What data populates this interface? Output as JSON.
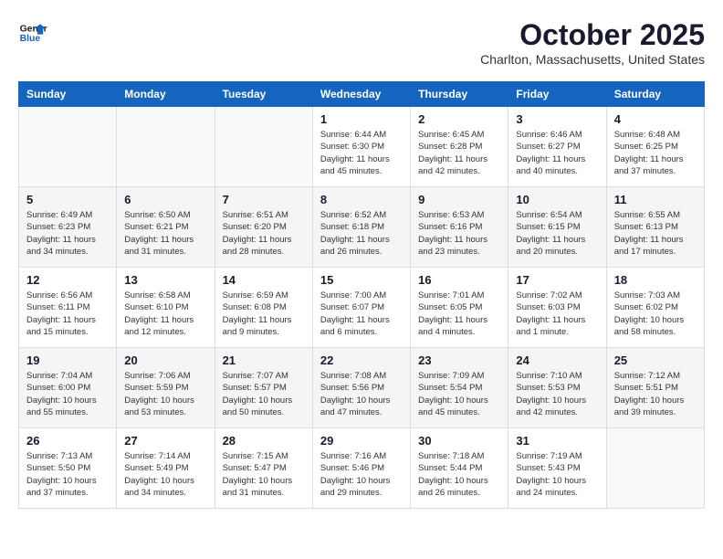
{
  "header": {
    "logo_line1": "General",
    "logo_line2": "Blue",
    "month": "October 2025",
    "location": "Charlton, Massachusetts, United States"
  },
  "days_of_week": [
    "Sunday",
    "Monday",
    "Tuesday",
    "Wednesday",
    "Thursday",
    "Friday",
    "Saturday"
  ],
  "weeks": [
    [
      {
        "day": "",
        "info": ""
      },
      {
        "day": "",
        "info": ""
      },
      {
        "day": "",
        "info": ""
      },
      {
        "day": "1",
        "info": "Sunrise: 6:44 AM\nSunset: 6:30 PM\nDaylight: 11 hours\nand 45 minutes."
      },
      {
        "day": "2",
        "info": "Sunrise: 6:45 AM\nSunset: 6:28 PM\nDaylight: 11 hours\nand 42 minutes."
      },
      {
        "day": "3",
        "info": "Sunrise: 6:46 AM\nSunset: 6:27 PM\nDaylight: 11 hours\nand 40 minutes."
      },
      {
        "day": "4",
        "info": "Sunrise: 6:48 AM\nSunset: 6:25 PM\nDaylight: 11 hours\nand 37 minutes."
      }
    ],
    [
      {
        "day": "5",
        "info": "Sunrise: 6:49 AM\nSunset: 6:23 PM\nDaylight: 11 hours\nand 34 minutes."
      },
      {
        "day": "6",
        "info": "Sunrise: 6:50 AM\nSunset: 6:21 PM\nDaylight: 11 hours\nand 31 minutes."
      },
      {
        "day": "7",
        "info": "Sunrise: 6:51 AM\nSunset: 6:20 PM\nDaylight: 11 hours\nand 28 minutes."
      },
      {
        "day": "8",
        "info": "Sunrise: 6:52 AM\nSunset: 6:18 PM\nDaylight: 11 hours\nand 26 minutes."
      },
      {
        "day": "9",
        "info": "Sunrise: 6:53 AM\nSunset: 6:16 PM\nDaylight: 11 hours\nand 23 minutes."
      },
      {
        "day": "10",
        "info": "Sunrise: 6:54 AM\nSunset: 6:15 PM\nDaylight: 11 hours\nand 20 minutes."
      },
      {
        "day": "11",
        "info": "Sunrise: 6:55 AM\nSunset: 6:13 PM\nDaylight: 11 hours\nand 17 minutes."
      }
    ],
    [
      {
        "day": "12",
        "info": "Sunrise: 6:56 AM\nSunset: 6:11 PM\nDaylight: 11 hours\nand 15 minutes."
      },
      {
        "day": "13",
        "info": "Sunrise: 6:58 AM\nSunset: 6:10 PM\nDaylight: 11 hours\nand 12 minutes."
      },
      {
        "day": "14",
        "info": "Sunrise: 6:59 AM\nSunset: 6:08 PM\nDaylight: 11 hours\nand 9 minutes."
      },
      {
        "day": "15",
        "info": "Sunrise: 7:00 AM\nSunset: 6:07 PM\nDaylight: 11 hours\nand 6 minutes."
      },
      {
        "day": "16",
        "info": "Sunrise: 7:01 AM\nSunset: 6:05 PM\nDaylight: 11 hours\nand 4 minutes."
      },
      {
        "day": "17",
        "info": "Sunrise: 7:02 AM\nSunset: 6:03 PM\nDaylight: 11 hours\nand 1 minute."
      },
      {
        "day": "18",
        "info": "Sunrise: 7:03 AM\nSunset: 6:02 PM\nDaylight: 10 hours\nand 58 minutes."
      }
    ],
    [
      {
        "day": "19",
        "info": "Sunrise: 7:04 AM\nSunset: 6:00 PM\nDaylight: 10 hours\nand 55 minutes."
      },
      {
        "day": "20",
        "info": "Sunrise: 7:06 AM\nSunset: 5:59 PM\nDaylight: 10 hours\nand 53 minutes."
      },
      {
        "day": "21",
        "info": "Sunrise: 7:07 AM\nSunset: 5:57 PM\nDaylight: 10 hours\nand 50 minutes."
      },
      {
        "day": "22",
        "info": "Sunrise: 7:08 AM\nSunset: 5:56 PM\nDaylight: 10 hours\nand 47 minutes."
      },
      {
        "day": "23",
        "info": "Sunrise: 7:09 AM\nSunset: 5:54 PM\nDaylight: 10 hours\nand 45 minutes."
      },
      {
        "day": "24",
        "info": "Sunrise: 7:10 AM\nSunset: 5:53 PM\nDaylight: 10 hours\nand 42 minutes."
      },
      {
        "day": "25",
        "info": "Sunrise: 7:12 AM\nSunset: 5:51 PM\nDaylight: 10 hours\nand 39 minutes."
      }
    ],
    [
      {
        "day": "26",
        "info": "Sunrise: 7:13 AM\nSunset: 5:50 PM\nDaylight: 10 hours\nand 37 minutes."
      },
      {
        "day": "27",
        "info": "Sunrise: 7:14 AM\nSunset: 5:49 PM\nDaylight: 10 hours\nand 34 minutes."
      },
      {
        "day": "28",
        "info": "Sunrise: 7:15 AM\nSunset: 5:47 PM\nDaylight: 10 hours\nand 31 minutes."
      },
      {
        "day": "29",
        "info": "Sunrise: 7:16 AM\nSunset: 5:46 PM\nDaylight: 10 hours\nand 29 minutes."
      },
      {
        "day": "30",
        "info": "Sunrise: 7:18 AM\nSunset: 5:44 PM\nDaylight: 10 hours\nand 26 minutes."
      },
      {
        "day": "31",
        "info": "Sunrise: 7:19 AM\nSunset: 5:43 PM\nDaylight: 10 hours\nand 24 minutes."
      },
      {
        "day": "",
        "info": ""
      }
    ]
  ]
}
